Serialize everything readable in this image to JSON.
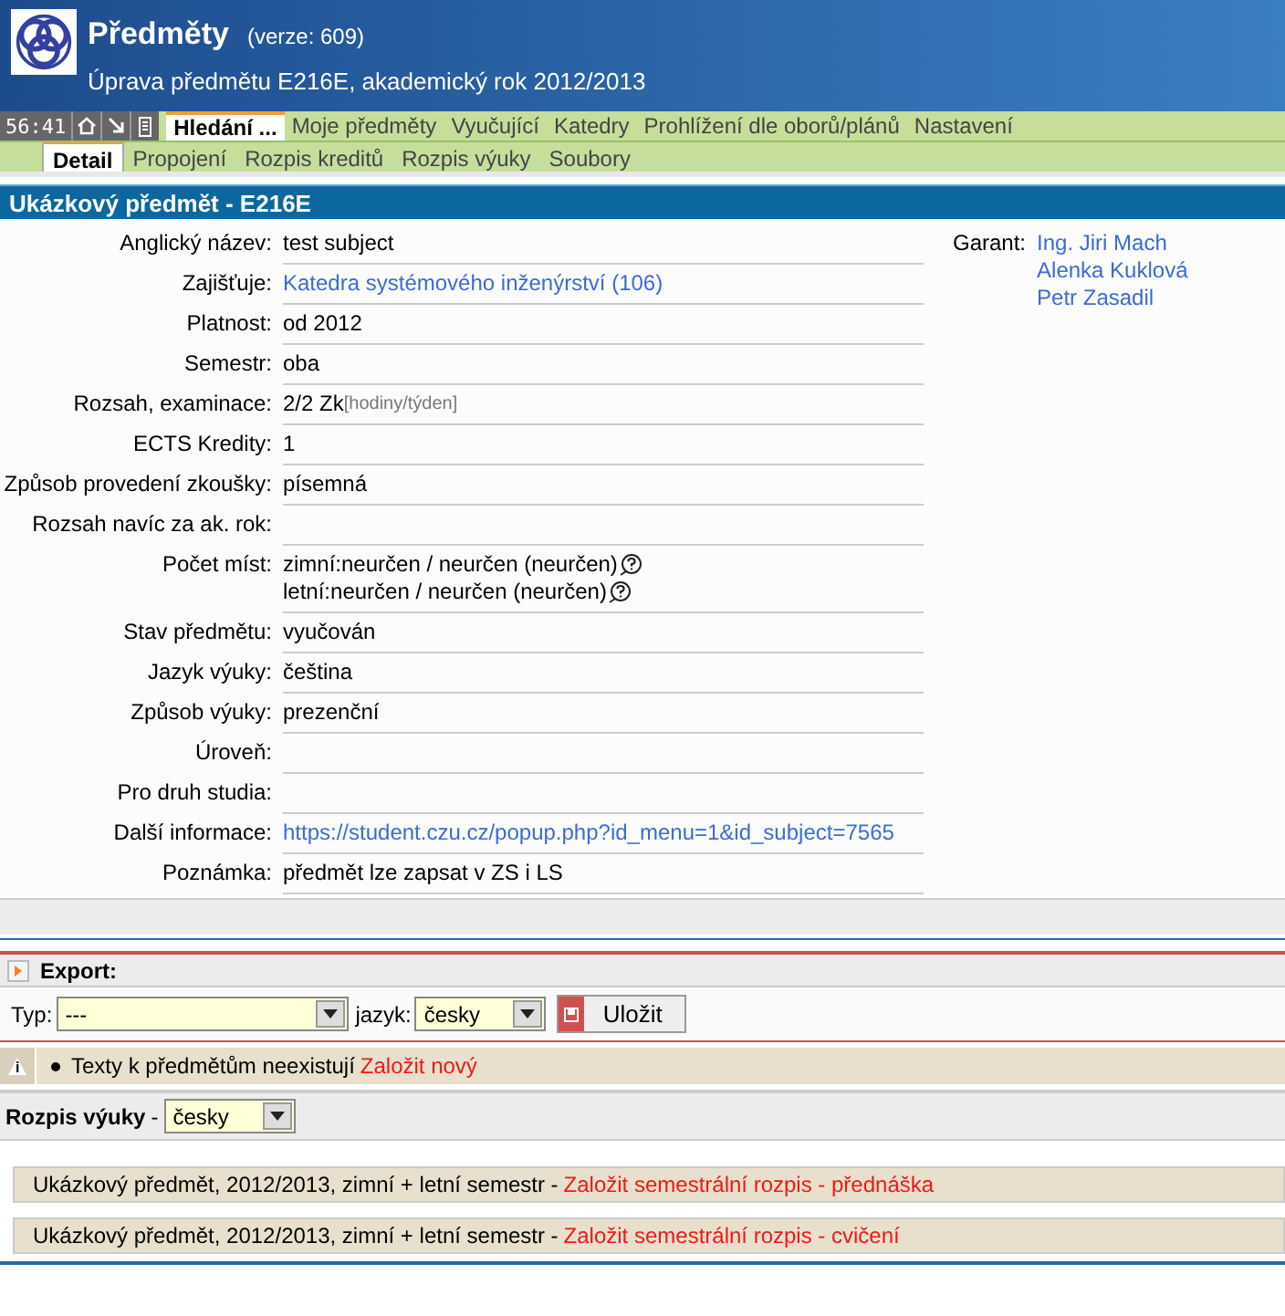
{
  "header": {
    "title": "Předměty",
    "version": "(verze: 609)",
    "subtitle": "Úprava předmětu E216E, akademický rok 2012/2013"
  },
  "toolbar": {
    "timer": "56:41"
  },
  "tabs": [
    {
      "label": "Hledání ...",
      "selected": true
    },
    {
      "label": "Moje předměty",
      "selected": false
    },
    {
      "label": "Vyučující",
      "selected": false
    },
    {
      "label": "Katedry",
      "selected": false
    },
    {
      "label": "Prohlížení dle oborů/plánů",
      "selected": false
    },
    {
      "label": "Nastavení",
      "selected": false
    }
  ],
  "subtabs": [
    {
      "label": "Detail",
      "selected": true
    },
    {
      "label": "Propojení",
      "selected": false
    },
    {
      "label": "Rozpis kreditů",
      "selected": false
    },
    {
      "label": "Rozpis výuky",
      "selected": false
    },
    {
      "label": "Soubory",
      "selected": false
    }
  ],
  "section_title": "Ukázkový předmět - E216E",
  "fields": [
    {
      "kind": "text",
      "label": "Anglický název:",
      "value": "test subject"
    },
    {
      "kind": "link",
      "label": "Zajišťuje:",
      "value": "Katedra systémového inženýrství (106)"
    },
    {
      "kind": "text",
      "label": "Platnost:",
      "value": "od 2012"
    },
    {
      "kind": "text",
      "label": "Semestr:",
      "value": "oba"
    },
    {
      "kind": "unit",
      "label": "Rozsah, examinace:",
      "value": "2/2 Zk",
      "unit": "[hodiny/týden]"
    },
    {
      "kind": "text",
      "label": "ECTS Kredity:",
      "value": "1"
    },
    {
      "kind": "text",
      "label": "Způsob provedení zkoušky:",
      "value": "písemná"
    },
    {
      "kind": "text",
      "label": "Rozsah navíc za ak. rok:"
    },
    {
      "kind": "help",
      "label": "Počet míst:",
      "lines": [
        "zimní:neurčen / neurčen (neurčen)",
        "letní:neurčen / neurčen (neurčen)"
      ]
    },
    {
      "kind": "text",
      "label": "Stav předmětu:",
      "value": "vyučován"
    },
    {
      "kind": "text",
      "label": "Jazyk výuky:",
      "value": "čeština"
    },
    {
      "kind": "text",
      "label": "Způsob výuky:",
      "value": "prezenční"
    },
    {
      "kind": "text",
      "label": "Úroveň:"
    },
    {
      "kind": "text",
      "label": "Pro druh studia:"
    },
    {
      "kind": "link",
      "label": "Další informace:",
      "value": "https://student.czu.cz/popup.php?id_menu=1&id_subject=7565"
    },
    {
      "kind": "text",
      "label": "Poznámka:",
      "value": "předmět lze zapsat v ZS i LS"
    }
  ],
  "garant": {
    "label": "Garant:",
    "names": [
      "Ing. Jiri Mach",
      "Alenka Kuklová",
      "Petr Zasadil"
    ]
  },
  "export": {
    "title": "Export:",
    "type_label": "Typ:",
    "type_value": "---",
    "language_label": "jazyk:",
    "language_value": "česky",
    "save": "Uložit"
  },
  "notice": {
    "text": "Texty k předmětům neexistují",
    "link": "Založit nový"
  },
  "schedule": {
    "title": "Rozpis výuky",
    "separator": "-",
    "language_value": "česky",
    "items": [
      {
        "text": "Ukázkový předmět, 2012/2013, zimní + letní semestr -",
        "link": "Založit semestrální rozpis - přednáška"
      },
      {
        "text": "Ukázkový předmět, 2012/2013, zimní + letní semestr -",
        "link": "Založit semestrální rozpis - cvičení"
      }
    ]
  }
}
